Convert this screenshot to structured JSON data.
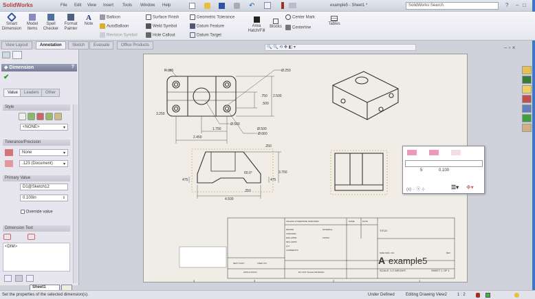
{
  "app": {
    "title": "SolidWorks",
    "document_title": "example5 - Sheet1 *",
    "search_placeholder": "SolidWorks Search"
  },
  "menu": [
    "File",
    "Edit",
    "View",
    "Insert",
    "Tools",
    "Window",
    "Help"
  ],
  "ribbon": {
    "large": [
      "Smart Dimension",
      "Model Items",
      "Spell Checker",
      "Format Painter",
      "Note"
    ],
    "col1": [
      "Balloon",
      "AutoBalloon",
      "Revision Symbol"
    ],
    "col2": [
      "Surface Finish",
      "Weld Symbol",
      "Hole Callout"
    ],
    "col3": [
      "Geometric Tolerance",
      "Datum Feature",
      "Datum Target"
    ],
    "area": "Area Hatch/Fill",
    "blocks": "Blocks",
    "col4": [
      "Center Mark",
      "Centerline"
    ],
    "tables": "Tables"
  },
  "tabs": [
    "View Layout",
    "Annotation",
    "Sketch",
    "Evaluate",
    "Office Products"
  ],
  "active_tab": "Annotation",
  "panel": {
    "title": "Dimension",
    "subtabs": [
      "Value",
      "Leaders",
      "Other"
    ],
    "style_label": "Style",
    "style_value": "<NONE>",
    "tolerance_label": "Tolerance/Precision",
    "tolerance_value": "None",
    "precision_value": ".123 (Document)",
    "primary_label": "Primary Value",
    "primary_name": "D1@Sketch12",
    "primary_value": "0.100in",
    "override_label": "Override value",
    "dimtext_label": "Dimension Text",
    "dimtext_value": "<DIM>"
  },
  "sheet_tab": "Sheet1",
  "drawing": {
    "dims": [
      "R.380",
      "Ø.250",
      "2.500",
      ".750",
      ".500",
      "Ø.500",
      "1.750",
      "2.450",
      "3.250",
      "Ø.500",
      "Ø.660",
      ".250",
      "3.750",
      "475",
      "475",
      "4.500",
      "60.0°",
      ".250"
    ],
    "titleblock": {
      "title_label": "TITLE:",
      "size": "A",
      "dwg_no": "example5",
      "size_label": "SIZE  DWG. NO.",
      "rev": "REV",
      "scale": "SCALE: 1:2   WEIGHT:",
      "sheet": "SHEET 1 OF 1",
      "tolerances": "UNLESS OTHERWISE SPECIFIED:",
      "name": "NAME",
      "date": "DATE",
      "drawn": "DRAWN",
      "checked": "CHECKED",
      "eng": "ENG APPR.",
      "mfg": "MFG APPR.",
      "qa": "Q.A.",
      "comments": "COMMENTS:",
      "material": "MATERIAL",
      "finish": "FINISH",
      "next": "NEXT ASSY",
      "used": "USED ON",
      "app": "APPLICATION",
      "dont": "DO NOT SCALE DRAWING"
    },
    "zones": [
      "4",
      "3",
      "2",
      "1"
    ]
  },
  "popup": {
    "value": "0.100",
    "tol": "5"
  },
  "status": {
    "hint": "Set the properties of the selected dimension(s).",
    "state": "Under Defined",
    "mode": "Editing Drawing View2",
    "scale": "1 : 2"
  },
  "colors": {
    "accent": "#3a78c0",
    "sheet": "#efede6",
    "ok": "#2a9a2a"
  }
}
